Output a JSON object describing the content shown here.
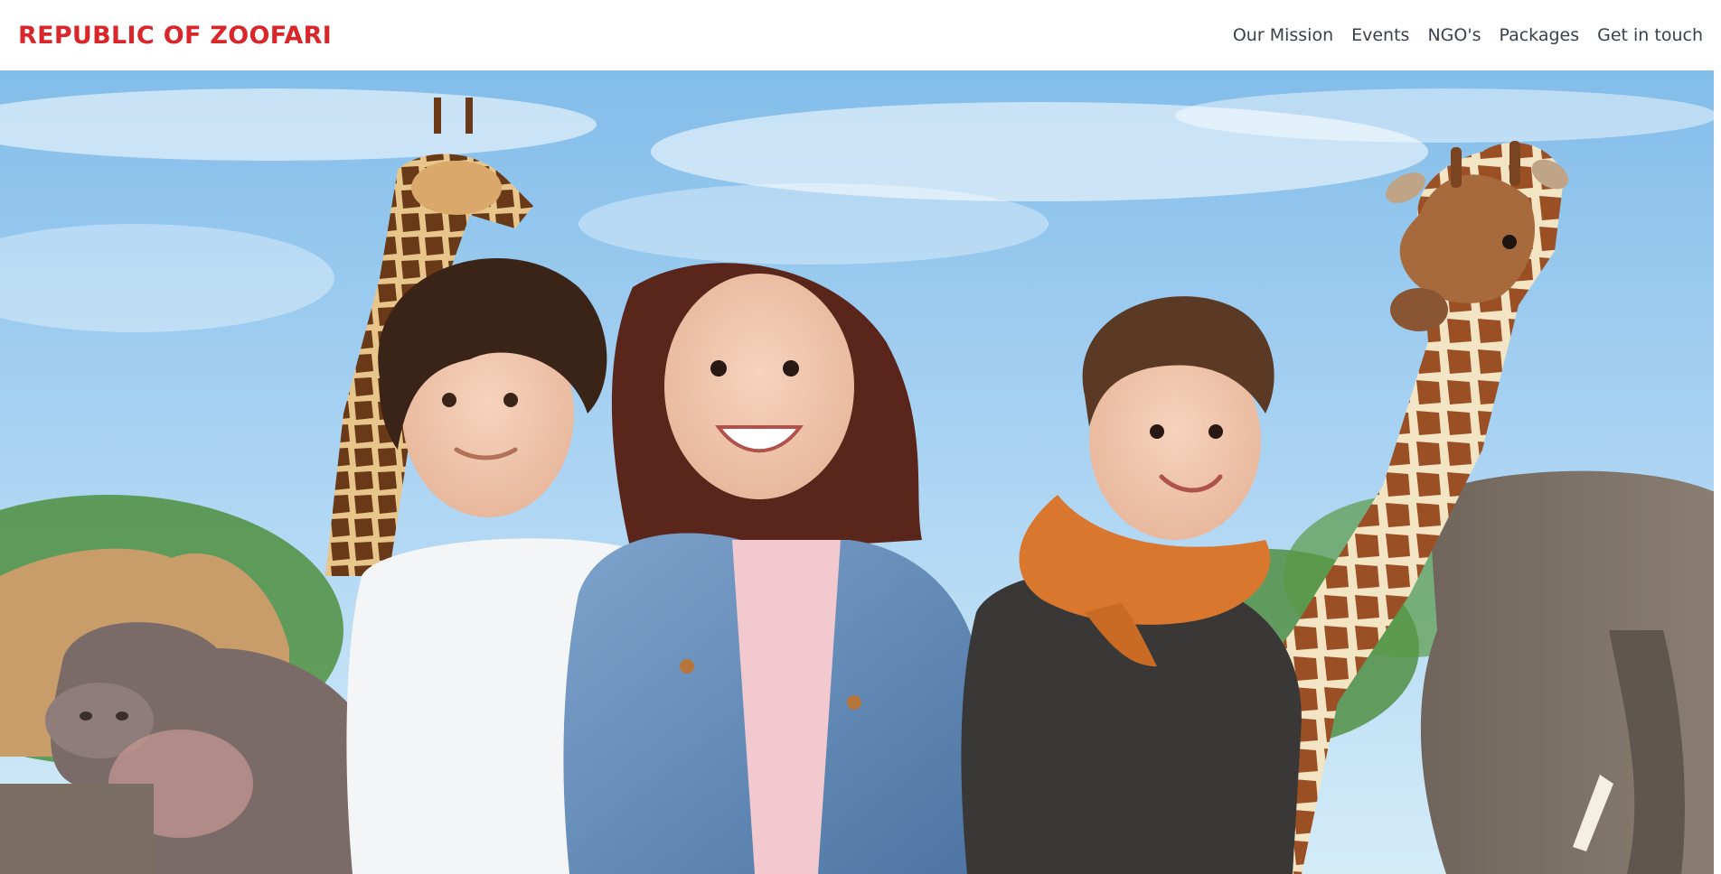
{
  "brand": {
    "title": "REPUBLIC OF ZOOFARI",
    "color": "#d9262b"
  },
  "nav": {
    "items": [
      {
        "label": "Our Mission"
      },
      {
        "label": "Events"
      },
      {
        "label": "NGO's"
      },
      {
        "label": "Packages"
      },
      {
        "label": "Get in touch"
      }
    ]
  },
  "hero": {
    "image_description": "Three smiling children posing with giraffes, a hippo, a camel and an elephant against a blue sky"
  },
  "colors": {
    "sky": "#9ccbef",
    "foliage": "#4f8f3e",
    "nav_text": "#3b3f4a"
  }
}
